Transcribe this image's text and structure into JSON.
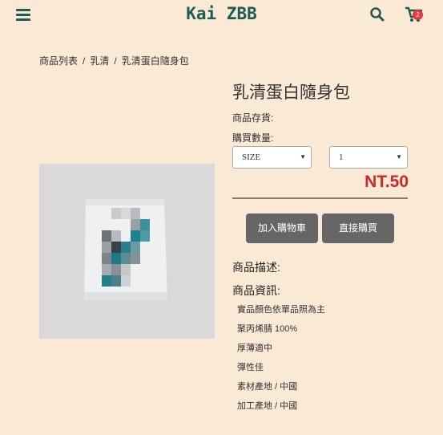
{
  "header": {
    "brand": "Kai ZBB",
    "cart_count": "2"
  },
  "breadcrumb": {
    "items": [
      "商品列表",
      "乳清",
      "乳清蛋白隨身包"
    ],
    "separator": "/"
  },
  "product": {
    "title": "乳清蛋白隨身包",
    "stock_label": "商品存貨:",
    "quantity_label": "購買數量:",
    "size_select": {
      "selected": "SIZE"
    },
    "quantity_select": {
      "selected": "1"
    },
    "price": "NT.50",
    "add_to_cart_label": "加入購物車",
    "buy_now_label": "直接購買",
    "description_title": "商品描述:",
    "info_title": "商品資訊:",
    "specs": [
      "實品顏色依單品照為主",
      "聚丙烯腈 100%",
      "厚薄適中",
      "彈性佳",
      "素材產地 / 中國",
      "加工產地 / 中國"
    ]
  },
  "colors": {
    "background": "#fae9d5",
    "brand": "#1f5c57",
    "price": "#c92a2a",
    "button": "#666666",
    "badge": "#e0393e"
  },
  "icons": [
    "menu-icon",
    "search-icon",
    "cart-icon"
  ]
}
